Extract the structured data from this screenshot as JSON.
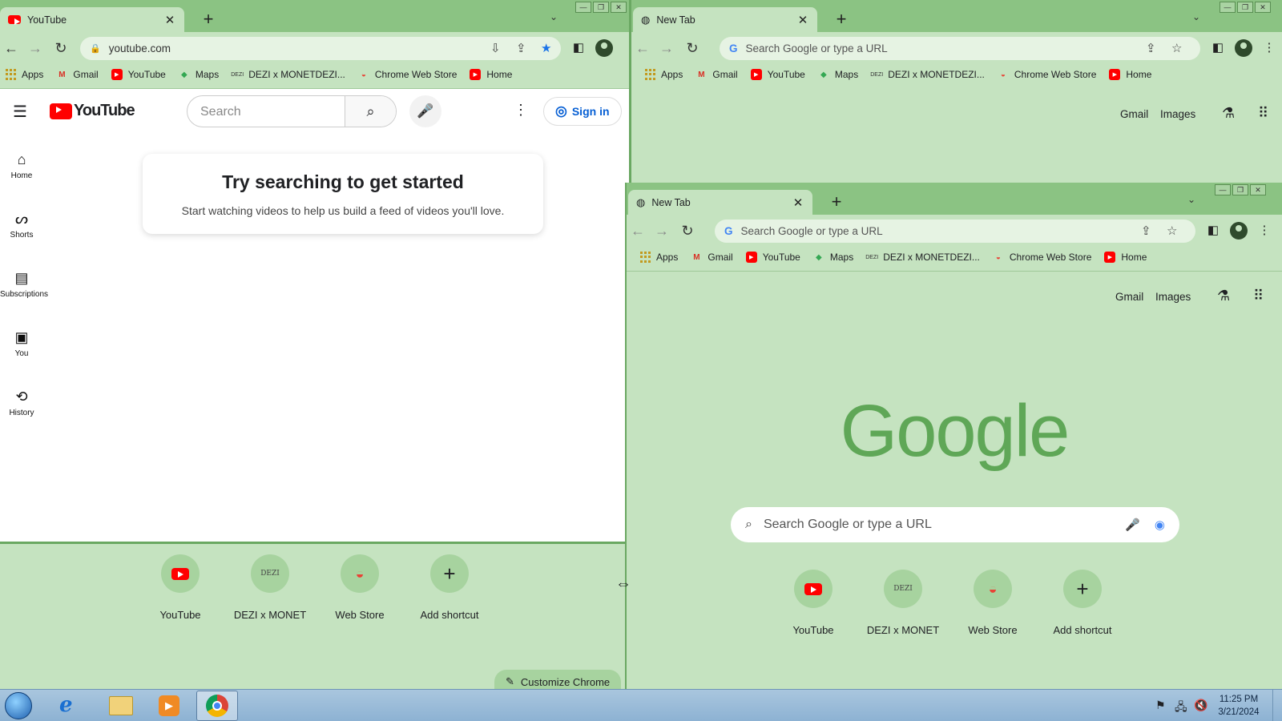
{
  "left_window": {
    "tab": {
      "title": "YouTube"
    },
    "url": "youtube.com",
    "bookmarks": [
      "Apps",
      "Gmail",
      "YouTube",
      "Maps",
      "DEZI x MONETDEZI...",
      "Chrome Web Store",
      "Home"
    ],
    "youtube": {
      "logo_text": "YouTube",
      "search_placeholder": "Search",
      "sign_in": "Sign in",
      "sidebar": [
        "Home",
        "Shorts",
        "Subscriptions",
        "You",
        "History"
      ],
      "card_title": "Try searching to get started",
      "card_text": "Start watching videos to help us build a feed of videos you'll love."
    },
    "shortcuts": [
      "YouTube",
      "DEZI x MONET",
      "Web Store",
      "Add shortcut"
    ],
    "customize": "Customize Chrome"
  },
  "right_back_window": {
    "tab": {
      "title": "New Tab"
    },
    "omnibox_placeholder": "Search Google or type a URL",
    "bookmarks": [
      "Apps",
      "Gmail",
      "YouTube",
      "Maps",
      "DEZI x MONETDEZI...",
      "Chrome Web Store",
      "Home"
    ],
    "links": [
      "Gmail",
      "Images"
    ]
  },
  "right_front_window": {
    "tab": {
      "title": "New Tab"
    },
    "omnibox_placeholder": "Search Google or type a URL",
    "bookmarks": [
      "Apps",
      "Gmail",
      "YouTube",
      "Maps",
      "DEZI x MONETDEZI...",
      "Chrome Web Store",
      "Home"
    ],
    "links": [
      "Gmail",
      "Images"
    ],
    "google_logo": "Google",
    "search_placeholder": "Search Google or type a URL",
    "shortcuts": [
      "YouTube",
      "DEZI x MONET",
      "Web Store",
      "Add shortcut"
    ]
  },
  "shortcut_icon_text": "DEZI",
  "taskbar": {
    "time": "11:25 PM",
    "date": "3/21/2024"
  },
  "colors": {
    "frame": "#8bc383",
    "background": "#c5e3c0",
    "youtube_red": "#ff0000"
  }
}
